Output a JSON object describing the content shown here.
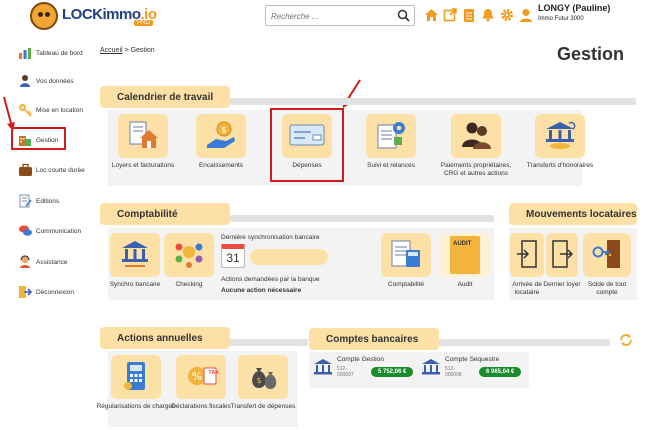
{
  "header": {
    "logo_text": "LOCKimmo",
    "logo_suffix": ".io",
    "logo_badge": "PRO",
    "search_placeholder": "Recherche ...",
    "user_name": "LONGY (Pauline)",
    "user_company": "Immo Futur 3000"
  },
  "sidebar": {
    "items": [
      {
        "label": "Tableau de bord"
      },
      {
        "label": "Vos données"
      },
      {
        "label": "Mise en location"
      },
      {
        "label": "Gestion"
      },
      {
        "label": "Loc courte durée"
      },
      {
        "label": "Editions"
      },
      {
        "label": "Communication"
      },
      {
        "label": "Assistance"
      },
      {
        "label": "Déconnexion"
      }
    ]
  },
  "breadcrumb": {
    "home": "Accueil",
    "separator": ">",
    "current": "Gestion"
  },
  "page_title": "Gestion",
  "calendrier": {
    "title": "Calendrier de travail",
    "tiles": [
      {
        "label": "Loyers et facturations"
      },
      {
        "label": "Encaissements"
      },
      {
        "label": "Dépenses"
      },
      {
        "label": "Suivi et relances"
      },
      {
        "label": "Paiements propriétaires, CRG et autres actions"
      },
      {
        "label": "Transferts d'honoraires"
      }
    ]
  },
  "comptabilite": {
    "title": "Comptabilité",
    "tiles": [
      {
        "label": "Synchro bancaire"
      },
      {
        "label": "Checking"
      },
      {
        "label": "Comptabilité"
      },
      {
        "label": "Audit"
      }
    ],
    "sync_label": "Dernière synchronisation bancaire",
    "calendar_day": "31",
    "actions_label": "Actions demandées par la banque",
    "actions_value": "Aucune action nécessaire",
    "audit_doc_label": "AUDIT"
  },
  "mouvements": {
    "title": "Mouvements locataires",
    "tiles": [
      {
        "label": "Arrivée de locataire"
      },
      {
        "label": "Dernier loyer"
      },
      {
        "label": "Solde de tout compte"
      }
    ]
  },
  "actions_annuelles": {
    "title": "Actions annuelles",
    "tiles": [
      {
        "label": "Régularisations de charges"
      },
      {
        "label": "Déclarations fiscales"
      },
      {
        "label": "Transfert de dépenses"
      }
    ],
    "tax_label": "TAX"
  },
  "comptes_bancaires": {
    "title": "Comptes bancaires",
    "accounts": [
      {
        "name": "Compte Gestion",
        "number_line1": "512-",
        "number_line2": "000007",
        "balance": "5 752,06 €"
      },
      {
        "name": "Compte Séquestre",
        "number_line1": "512-",
        "number_line2": "000008",
        "balance": "6 965,04 €"
      }
    ]
  },
  "colors": {
    "accent": "#f29a1c",
    "section_bg": "#fde0a6",
    "highlight": "#d21c1c",
    "balance_bg": "#1b8c2e"
  }
}
